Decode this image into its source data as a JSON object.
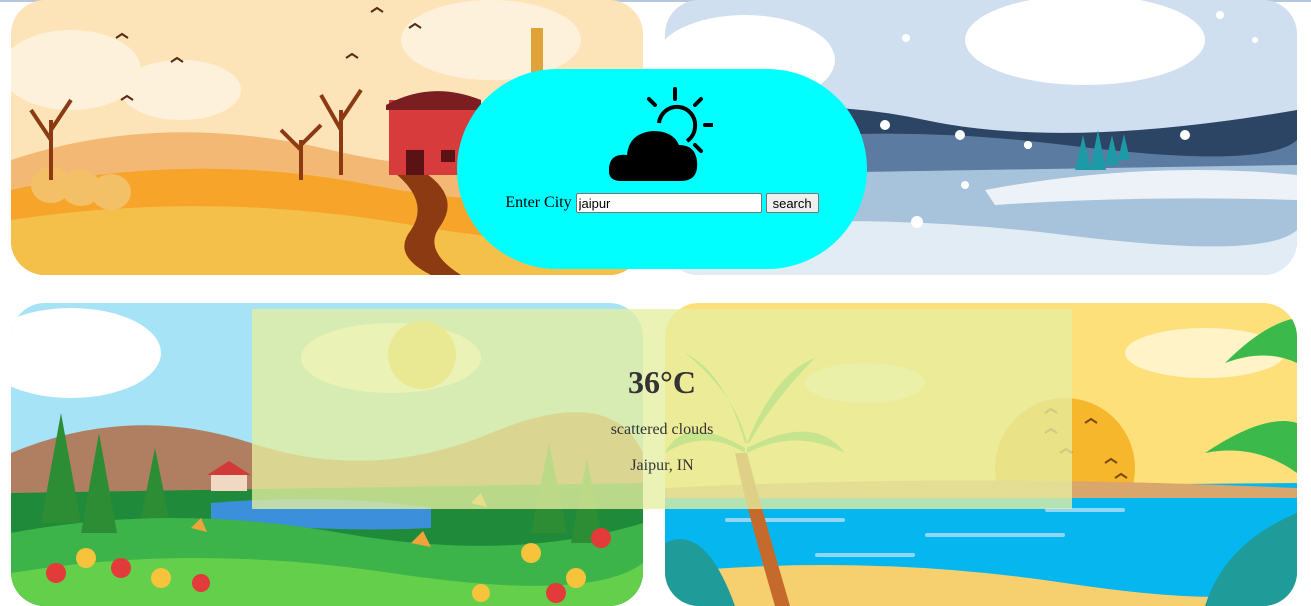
{
  "app": {
    "search": {
      "label": "Enter City",
      "value": "jaipur",
      "button_label": "search",
      "icon": "partly-cloudy-icon"
    },
    "result": {
      "temperature": "36°C",
      "description": "scattered clouds",
      "location": "Jaipur, IN"
    },
    "panels": [
      {
        "season": "autumn",
        "icon": "farm-landscape-illustration"
      },
      {
        "season": "winter",
        "icon": "snowy-landscape-illustration"
      },
      {
        "season": "spring",
        "icon": "flower-meadow-illustration"
      },
      {
        "season": "summer",
        "icon": "beach-illustration"
      }
    ],
    "colors": {
      "search_pill": "#00ffff",
      "result_overlay": "#e6eea0"
    }
  }
}
